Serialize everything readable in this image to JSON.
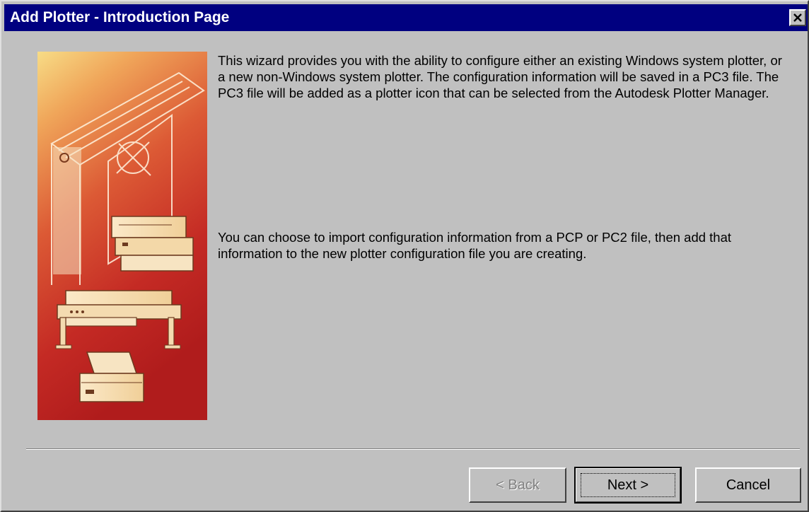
{
  "window": {
    "title": "Add Plotter - Introduction Page",
    "close_glyph": "✕"
  },
  "content": {
    "paragraph_1": "This wizard provides you with the ability to configure either an existing Windows system plotter, or a new non-Windows system plotter. The configuration information will be saved in a PC3 file. The PC3 file will be added as a plotter icon that can be selected from the Autodesk Plotter Manager.",
    "paragraph_2": "You can choose to import configuration information from a PCP or PC2 file, then add that information to the new plotter configuration file you are creating."
  },
  "buttons": {
    "back_label": "< Back",
    "next_label": "Next >",
    "cancel_label": "Cancel"
  },
  "colors": {
    "titlebar": "#000080",
    "dialog_face": "#c0c0c0",
    "graphic_top": "#f4d27a",
    "graphic_bottom": "#b81f1f"
  }
}
